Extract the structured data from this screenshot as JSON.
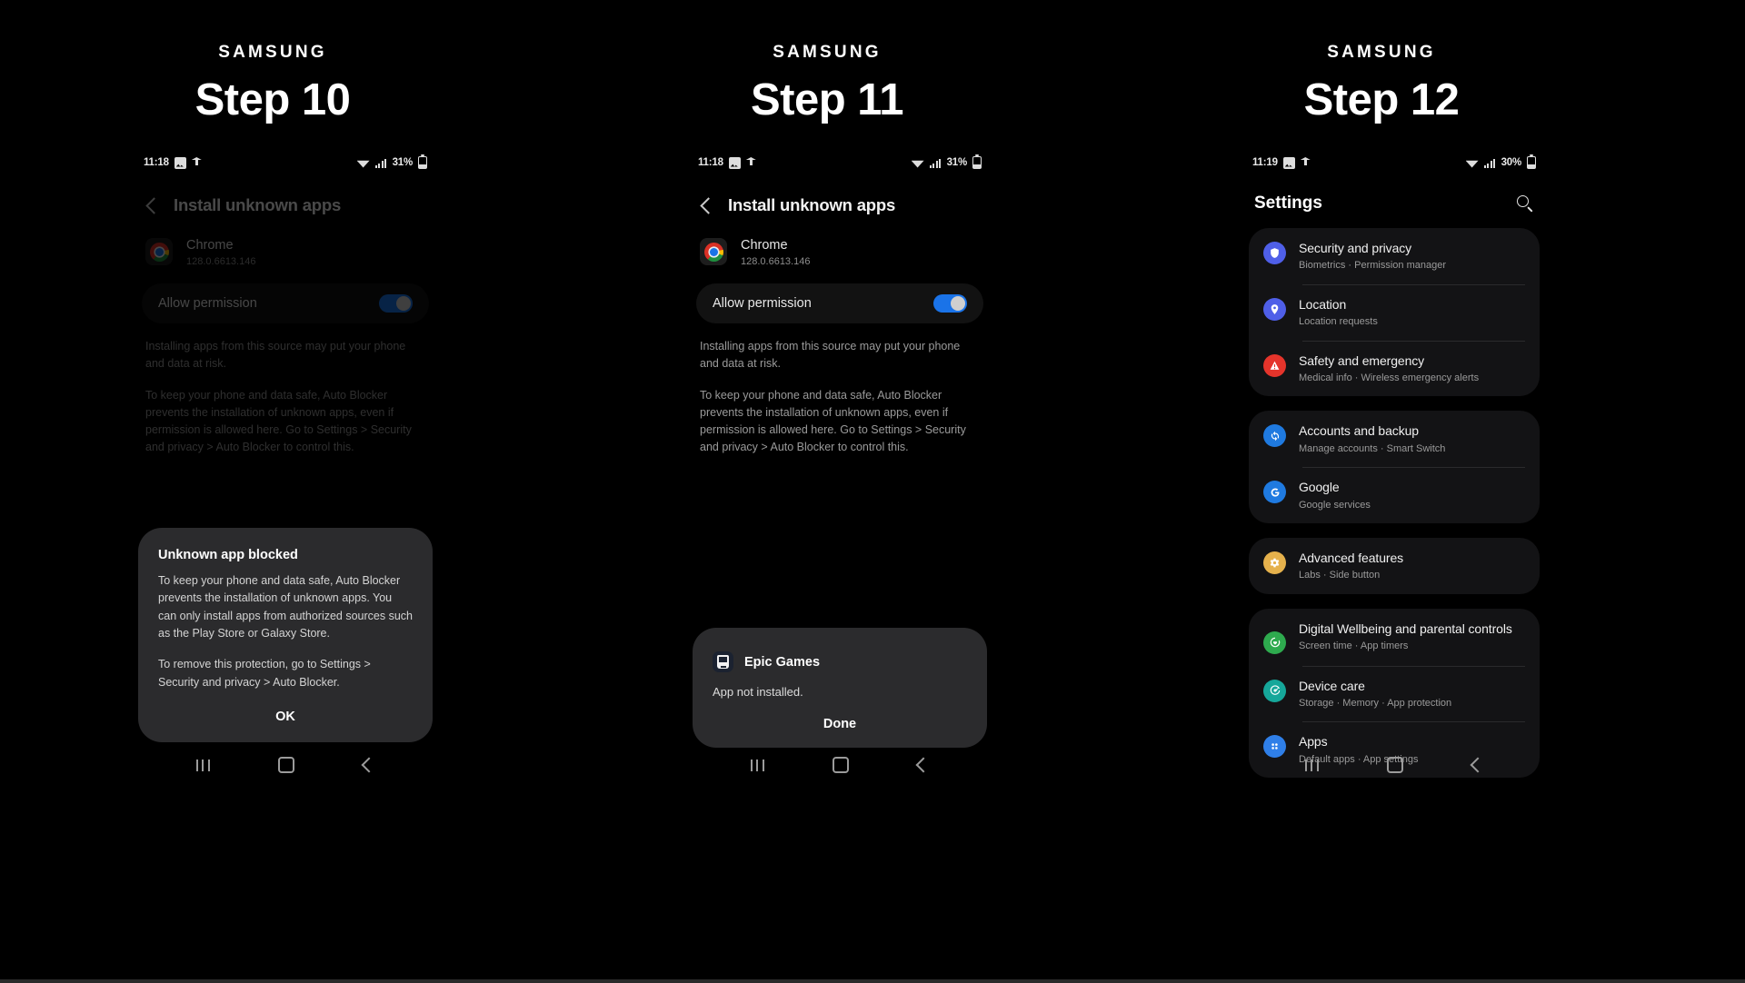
{
  "panels": [
    {
      "brand": "SAMSUNG",
      "step_title": "Step 10",
      "status": {
        "time": "11:18",
        "battery": "31%",
        "icons": [
          "photo-icon",
          "upload-icon",
          "wifi-icon",
          "signal-icon",
          "battery-icon"
        ]
      },
      "screen": {
        "header_title": "Install unknown apps",
        "app_name": "Chrome",
        "app_version": "128.0.6613.146",
        "permission_label": "Allow permission",
        "permission_enabled": true,
        "body_1": "Installing apps from this source may put your phone and data at risk.",
        "body_2": "To keep your phone and data safe, Auto Blocker prevents the installation of unknown apps, even if permission is allowed here. Go to Settings > Security and privacy > Auto Blocker to control this."
      },
      "dialog": {
        "title": "Unknown app blocked",
        "text_1": "To keep your phone and data safe, Auto Blocker prevents the installation of unknown apps. You can only install apps from authorized sources such as the Play Store or Galaxy Store.",
        "text_2": "To remove this protection, go to Settings > Security and privacy > Auto Blocker.",
        "action": "OK"
      }
    },
    {
      "brand": "SAMSUNG",
      "step_title": "Step 11",
      "status": {
        "time": "11:18",
        "battery": "31%",
        "icons": [
          "photo-icon",
          "upload-icon",
          "wifi-icon",
          "signal-icon",
          "battery-icon"
        ]
      },
      "screen": {
        "header_title": "Install unknown apps",
        "app_name": "Chrome",
        "app_version": "128.0.6613.146",
        "permission_label": "Allow permission",
        "permission_enabled": true,
        "body_1": "Installing apps from this source may put your phone and data at risk.",
        "body_2": "To keep your phone and data safe, Auto Blocker prevents the installation of unknown apps, even if permission is allowed here. Go to Settings > Security and privacy > Auto Blocker to control this."
      },
      "dialog": {
        "app_name": "Epic Games",
        "message": "App not installed.",
        "action": "Done"
      }
    },
    {
      "brand": "SAMSUNG",
      "step_title": "Step 12",
      "status": {
        "time": "11:19",
        "battery": "30%",
        "icons": [
          "photo-icon",
          "upload-icon",
          "wifi-icon",
          "signal-icon",
          "battery-icon"
        ]
      },
      "settings": {
        "title": "Settings",
        "search_icon": "search-icon",
        "cards": [
          {
            "rows": [
              {
                "label": "Security and privacy",
                "sub": "Biometrics  ·  Permission manager",
                "icon": "shield-icon",
                "color": "#4f5fe8"
              },
              {
                "label": "Location",
                "sub": "Location requests",
                "icon": "location-pin-icon",
                "color": "#4f5fe8"
              },
              {
                "label": "Safety and emergency",
                "sub": "Medical info  ·  Wireless emergency alerts",
                "icon": "emergency-icon",
                "color": "#e5342b"
              }
            ]
          },
          {
            "rows": [
              {
                "label": "Accounts and backup",
                "sub": "Manage accounts  ·  Smart Switch",
                "icon": "sync-icon",
                "color": "#1f7ae0"
              },
              {
                "label": "Google",
                "sub": "Google services",
                "icon": "google-g-icon",
                "color": "#1f7ae0"
              }
            ]
          },
          {
            "rows": [
              {
                "label": "Advanced features",
                "sub": "Labs  ·  Side button",
                "icon": "gear-icon",
                "color": "#e5b14c"
              }
            ]
          },
          {
            "rows": [
              {
                "label": "Digital Wellbeing and parental controls",
                "sub": "Screen time  ·  App timers",
                "icon": "wellbeing-heart-icon",
                "color": "#2eaa4e"
              },
              {
                "label": "Device care",
                "sub": "Storage  ·  Memory  ·  App protection",
                "icon": "device-care-icon",
                "color": "#16a79a"
              },
              {
                "label": "Apps",
                "sub": "Default apps  ·  App settings",
                "icon": "apps-grid-icon",
                "color": "#2f7fe8"
              }
            ]
          }
        ]
      }
    }
  ],
  "navbar": {
    "recent_label": "recent-apps",
    "home_label": "home",
    "back_label": "back"
  }
}
